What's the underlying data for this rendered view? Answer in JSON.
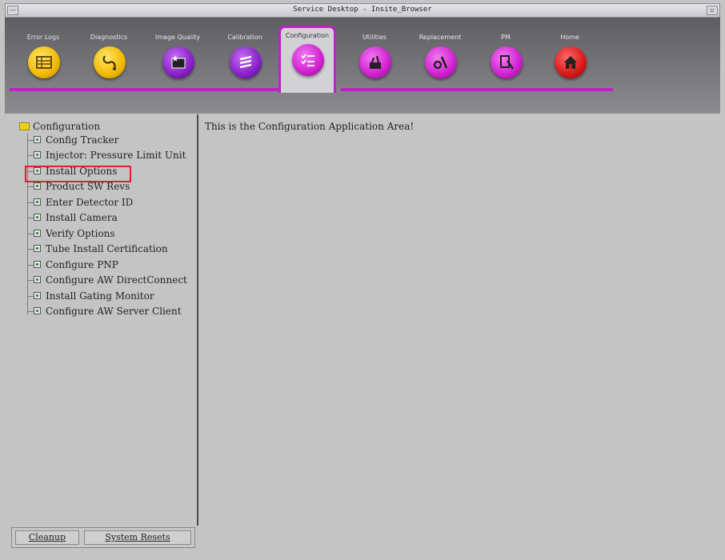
{
  "window": {
    "title": "Service Desktop - Insite_Browser"
  },
  "toolbar": {
    "tabs": [
      {
        "label": "Error Logs",
        "icon": "error-logs-icon",
        "color": "#f0b800"
      },
      {
        "label": "Diagnostics",
        "icon": "diagnostics-icon",
        "color": "#f0b800"
      },
      {
        "label": "Image Quality",
        "icon": "image-quality-icon",
        "color": "#8820c8"
      },
      {
        "label": "Calibration",
        "icon": "calibration-icon",
        "color": "#8820c8"
      },
      {
        "label": "Configuration",
        "icon": "configuration-icon",
        "color": "#d020d0",
        "active": true
      },
      {
        "label": "Utilities",
        "icon": "utilities-icon",
        "color": "#d020d0"
      },
      {
        "label": "Replacement",
        "icon": "replacement-icon",
        "color": "#d020d0"
      },
      {
        "label": "PM",
        "icon": "pm-icon",
        "color": "#d020d0"
      },
      {
        "label": "Home",
        "icon": "home-icon",
        "color": "#d81818"
      }
    ]
  },
  "tree": {
    "root": "Configuration",
    "items": [
      "Config Tracker",
      "Injector: Pressure Limit Unit",
      "Install Options",
      "Product SW Revs",
      "Enter Detector ID",
      "Install Camera",
      "Verify Options",
      "Tube Install Certification",
      "Configure PNP",
      "Configure AW DirectConnect",
      "Install Gating Monitor",
      "Configure AW Server Client"
    ],
    "highlighted": "Install Options"
  },
  "bottom": {
    "cleanup": "Cleanup",
    "system_resets": "System Resets"
  },
  "main": {
    "message": "This is the Configuration Application Area!"
  },
  "colors": {
    "accent": "#c020c8",
    "highlight": "#e02030"
  }
}
